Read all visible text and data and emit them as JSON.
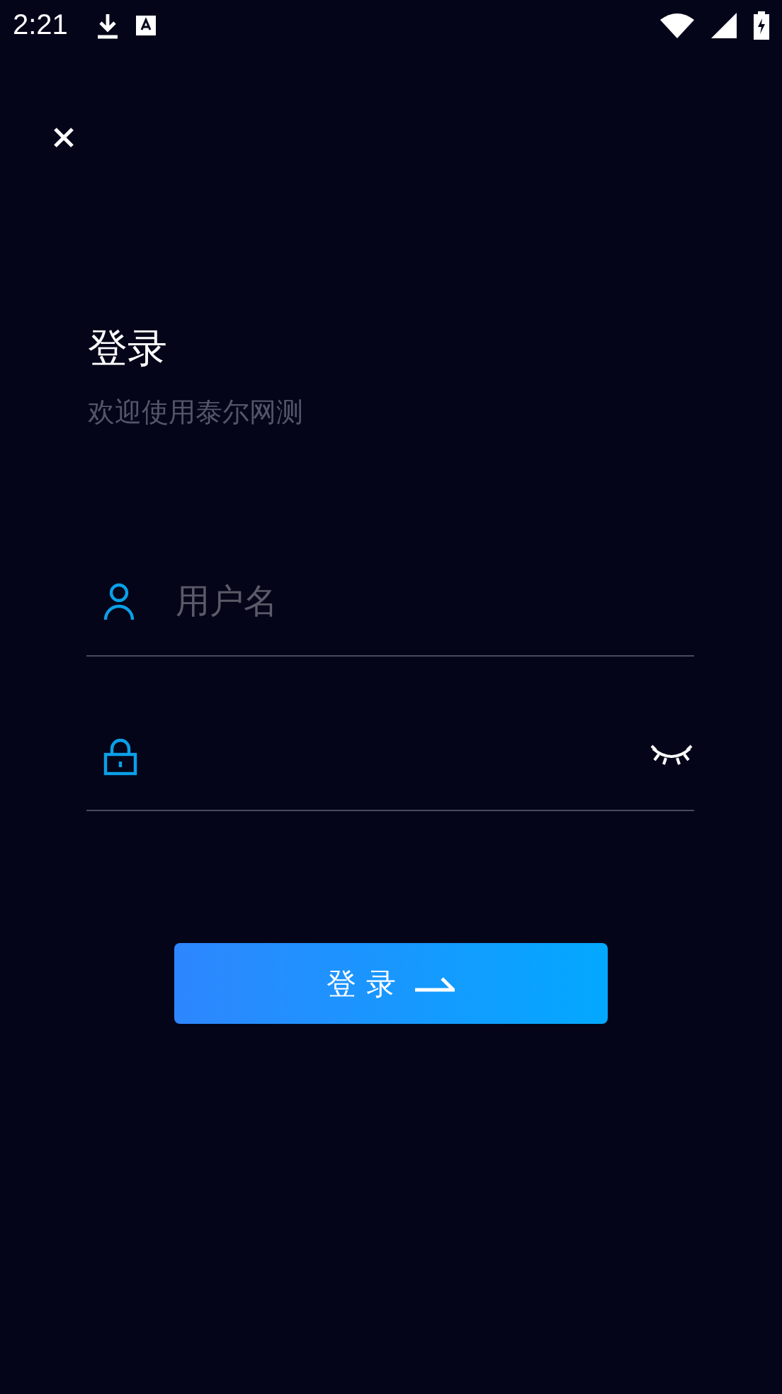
{
  "status_bar": {
    "time": "2:21"
  },
  "title": "登录",
  "subtitle": "欢迎使用泰尔网测",
  "username": {
    "placeholder": "用户名"
  },
  "password": {
    "visible": false
  },
  "login_button": {
    "label": "登 录"
  }
}
